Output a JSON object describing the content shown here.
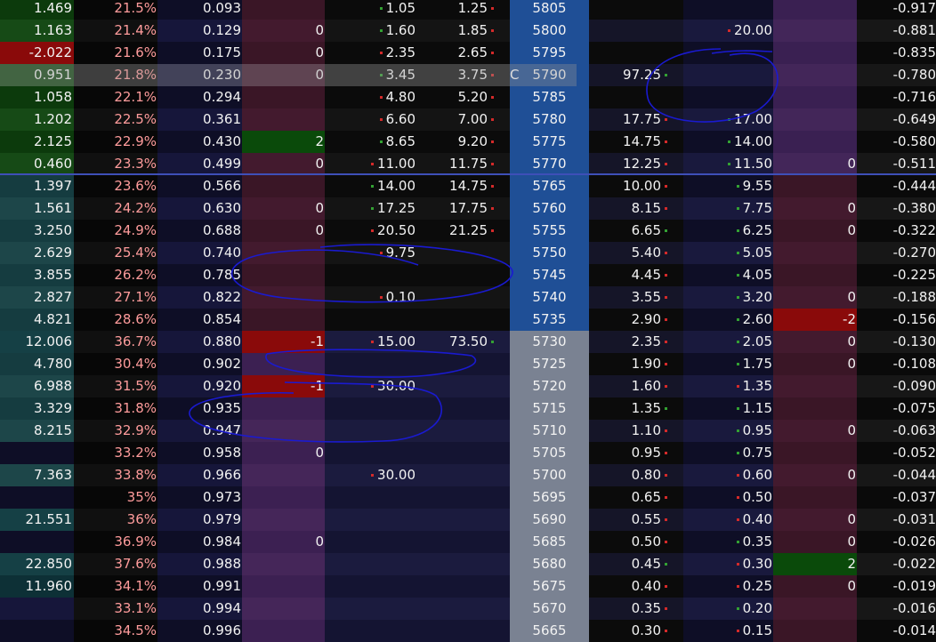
{
  "screen": {
    "name": "option-chain",
    "current_strike_flag": "C",
    "colors": {
      "text": "#f2f2f2",
      "iv_text": "#ff9c9c",
      "up_tick": "#33a133",
      "down_tick": "#d42a2a",
      "strike_itm": "#1f4f96",
      "strike_otm": "#7a8292",
      "annotation_ink": "#1010c8"
    }
  },
  "rows": [
    {
      "strike": "5805",
      "call_value": "1.469",
      "call_iv": "21.5%",
      "call_delta": "0.093",
      "call_pos": "",
      "call_bid": "1.05",
      "call_ask": "1.25",
      "bid_tick": "green",
      "ask_tick": "red",
      "put_bid": "",
      "put_ask": "",
      "pb_tick": "",
      "pa_tick": "",
      "put_pos": "",
      "put_delta": "-0.917"
    },
    {
      "strike": "5800",
      "call_value": "1.163",
      "call_iv": "21.4%",
      "call_delta": "0.129",
      "call_pos": "0",
      "call_bid": "1.60",
      "call_ask": "1.85",
      "bid_tick": "green",
      "ask_tick": "red",
      "put_bid": "",
      "put_ask": "20.00",
      "pb_tick": "",
      "pa_tick": "red",
      "put_pos": "",
      "put_delta": "-0.881"
    },
    {
      "strike": "5795",
      "call_value": "-2.022",
      "call_iv": "21.6%",
      "call_delta": "0.175",
      "call_pos": "0",
      "call_bid": "2.35",
      "call_ask": "2.65",
      "bid_tick": "red",
      "ask_tick": "red",
      "put_bid": "",
      "put_ask": "",
      "pb_tick": "",
      "pa_tick": "",
      "put_pos": "",
      "put_delta": "-0.835"
    },
    {
      "strike": "5790",
      "call_value": "0.951",
      "call_iv": "21.8%",
      "call_delta": "0.230",
      "call_pos": "0",
      "call_bid": "3.45",
      "call_ask": "3.75",
      "bid_tick": "green",
      "ask_tick": "red",
      "put_bid": "97.25",
      "put_ask": "",
      "pb_tick": "green",
      "pa_tick": "",
      "put_pos": "",
      "put_delta": "-0.780"
    },
    {
      "strike": "5785",
      "call_value": "1.058",
      "call_iv": "22.1%",
      "call_delta": "0.294",
      "call_pos": "",
      "call_bid": "4.80",
      "call_ask": "5.20",
      "bid_tick": "red",
      "ask_tick": "red",
      "put_bid": "",
      "put_ask": "",
      "pb_tick": "",
      "pa_tick": "",
      "put_pos": "",
      "put_delta": "-0.716"
    },
    {
      "strike": "5780",
      "call_value": "1.202",
      "call_iv": "22.5%",
      "call_delta": "0.361",
      "call_pos": "",
      "call_bid": "6.60",
      "call_ask": "7.00",
      "bid_tick": "red",
      "ask_tick": "red",
      "put_bid": "17.75",
      "put_ask": "17.00",
      "pb_tick": "red",
      "pa_tick": "green",
      "put_pos": "",
      "put_delta": "-0.649"
    },
    {
      "strike": "5775",
      "call_value": "2.125",
      "call_iv": "22.9%",
      "call_delta": "0.430",
      "call_pos": "2",
      "call_bid": "8.65",
      "call_ask": "9.20",
      "bid_tick": "green",
      "ask_tick": "red",
      "put_bid": "14.75",
      "put_ask": "14.00",
      "pb_tick": "red",
      "pa_tick": "green",
      "put_pos": "",
      "put_delta": "-0.580"
    },
    {
      "strike": "5770",
      "call_value": "0.460",
      "call_iv": "23.3%",
      "call_delta": "0.499",
      "call_pos": "0",
      "call_bid": "11.00",
      "call_ask": "11.75",
      "bid_tick": "red",
      "ask_tick": "red",
      "put_bid": "12.25",
      "put_ask": "11.50",
      "pb_tick": "red",
      "pa_tick": "green",
      "put_pos": "0",
      "put_delta": "-0.511"
    },
    {
      "strike": "5765",
      "call_value": "1.397",
      "call_iv": "23.6%",
      "call_delta": "0.566",
      "call_pos": "",
      "call_bid": "14.00",
      "call_ask": "14.75",
      "bid_tick": "green",
      "ask_tick": "red",
      "put_bid": "10.00",
      "put_ask": "9.55",
      "pb_tick": "red",
      "pa_tick": "green",
      "put_pos": "",
      "put_delta": "-0.444"
    },
    {
      "strike": "5760",
      "call_value": "1.561",
      "call_iv": "24.2%",
      "call_delta": "0.630",
      "call_pos": "0",
      "call_bid": "17.25",
      "call_ask": "17.75",
      "bid_tick": "green",
      "ask_tick": "red",
      "put_bid": "8.15",
      "put_ask": "7.75",
      "pb_tick": "red",
      "pa_tick": "green",
      "put_pos": "0",
      "put_delta": "-0.380"
    },
    {
      "strike": "5755",
      "call_value": "3.250",
      "call_iv": "24.9%",
      "call_delta": "0.688",
      "call_pos": "0",
      "call_bid": "20.50",
      "call_ask": "21.25",
      "bid_tick": "red",
      "ask_tick": "red",
      "put_bid": "6.65",
      "put_ask": "6.25",
      "pb_tick": "green",
      "pa_tick": "green",
      "put_pos": "0",
      "put_delta": "-0.322"
    },
    {
      "strike": "5750",
      "call_value": "2.629",
      "call_iv": "25.4%",
      "call_delta": "0.740",
      "call_pos": "",
      "call_bid": "9.75",
      "call_ask": "",
      "bid_tick": "red",
      "ask_tick": "",
      "put_bid": "5.40",
      "put_ask": "5.05",
      "pb_tick": "red",
      "pa_tick": "green",
      "put_pos": "",
      "put_delta": "-0.270"
    },
    {
      "strike": "5745",
      "call_value": "3.855",
      "call_iv": "26.2%",
      "call_delta": "0.785",
      "call_pos": "",
      "call_bid": "",
      "call_ask": "",
      "bid_tick": "",
      "ask_tick": "",
      "put_bid": "4.45",
      "put_ask": "4.05",
      "pb_tick": "red",
      "pa_tick": "green",
      "put_pos": "",
      "put_delta": "-0.225"
    },
    {
      "strike": "5740",
      "call_value": "2.827",
      "call_iv": "27.1%",
      "call_delta": "0.822",
      "call_pos": "",
      "call_bid": "0.10",
      "call_ask": "",
      "bid_tick": "red",
      "ask_tick": "",
      "put_bid": "3.55",
      "put_ask": "3.20",
      "pb_tick": "red",
      "pa_tick": "green",
      "put_pos": "0",
      "put_delta": "-0.188"
    },
    {
      "strike": "5735",
      "call_value": "4.821",
      "call_iv": "28.6%",
      "call_delta": "0.854",
      "call_pos": "",
      "call_bid": "",
      "call_ask": "",
      "bid_tick": "",
      "ask_tick": "",
      "put_bid": "2.90",
      "put_ask": "2.60",
      "pb_tick": "red",
      "pa_tick": "green",
      "put_pos": "-2",
      "put_delta": "-0.156"
    },
    {
      "strike": "5730",
      "call_value": "12.006",
      "call_iv": "36.7%",
      "call_delta": "0.880",
      "call_pos": "-1",
      "call_bid": "15.00",
      "call_ask": "73.50",
      "bid_tick": "red",
      "ask_tick": "green",
      "put_bid": "2.35",
      "put_ask": "2.05",
      "pb_tick": "red",
      "pa_tick": "green",
      "put_pos": "0",
      "put_delta": "-0.130"
    },
    {
      "strike": "5725",
      "call_value": "4.780",
      "call_iv": "30.4%",
      "call_delta": "0.902",
      "call_pos": "",
      "call_bid": "",
      "call_ask": "",
      "bid_tick": "",
      "ask_tick": "",
      "put_bid": "1.90",
      "put_ask": "1.75",
      "pb_tick": "red",
      "pa_tick": "green",
      "put_pos": "0",
      "put_delta": "-0.108"
    },
    {
      "strike": "5720",
      "call_value": "6.988",
      "call_iv": "31.5%",
      "call_delta": "0.920",
      "call_pos": "-1",
      "call_bid": "30.00",
      "call_ask": "",
      "bid_tick": "red",
      "ask_tick": "",
      "put_bid": "1.60",
      "put_ask": "1.35",
      "pb_tick": "red",
      "pa_tick": "red",
      "put_pos": "",
      "put_delta": "-0.090"
    },
    {
      "strike": "5715",
      "call_value": "3.329",
      "call_iv": "31.8%",
      "call_delta": "0.935",
      "call_pos": "",
      "call_bid": "",
      "call_ask": "",
      "bid_tick": "",
      "ask_tick": "",
      "put_bid": "1.35",
      "put_ask": "1.15",
      "pb_tick": "green",
      "pa_tick": "green",
      "put_pos": "",
      "put_delta": "-0.075"
    },
    {
      "strike": "5710",
      "call_value": "8.215",
      "call_iv": "32.9%",
      "call_delta": "0.947",
      "call_pos": "",
      "call_bid": "",
      "call_ask": "",
      "bid_tick": "",
      "ask_tick": "",
      "put_bid": "1.10",
      "put_ask": "0.95",
      "pb_tick": "red",
      "pa_tick": "green",
      "put_pos": "0",
      "put_delta": "-0.063"
    },
    {
      "strike": "5705",
      "call_value": "",
      "call_iv": "33.2%",
      "call_delta": "0.958",
      "call_pos": "0",
      "call_bid": "",
      "call_ask": "",
      "bid_tick": "",
      "ask_tick": "",
      "put_bid": "0.95",
      "put_ask": "0.75",
      "pb_tick": "red",
      "pa_tick": "green",
      "put_pos": "",
      "put_delta": "-0.052"
    },
    {
      "strike": "5700",
      "call_value": "7.363",
      "call_iv": "33.8%",
      "call_delta": "0.966",
      "call_pos": "",
      "call_bid": "30.00",
      "call_ask": "",
      "bid_tick": "red",
      "ask_tick": "",
      "put_bid": "0.80",
      "put_ask": "0.60",
      "pb_tick": "red",
      "pa_tick": "red",
      "put_pos": "0",
      "put_delta": "-0.044"
    },
    {
      "strike": "5695",
      "call_value": "",
      "call_iv": "35%",
      "call_delta": "0.973",
      "call_pos": "",
      "call_bid": "",
      "call_ask": "",
      "bid_tick": "",
      "ask_tick": "",
      "put_bid": "0.65",
      "put_ask": "0.50",
      "pb_tick": "red",
      "pa_tick": "red",
      "put_pos": "",
      "put_delta": "-0.037"
    },
    {
      "strike": "5690",
      "call_value": "21.551",
      "call_iv": "36%",
      "call_delta": "0.979",
      "call_pos": "",
      "call_bid": "",
      "call_ask": "",
      "bid_tick": "",
      "ask_tick": "",
      "put_bid": "0.55",
      "put_ask": "0.40",
      "pb_tick": "red",
      "pa_tick": "red",
      "put_pos": "0",
      "put_delta": "-0.031"
    },
    {
      "strike": "5685",
      "call_value": "",
      "call_iv": "36.9%",
      "call_delta": "0.984",
      "call_pos": "0",
      "call_bid": "",
      "call_ask": "",
      "bid_tick": "",
      "ask_tick": "",
      "put_bid": "0.50",
      "put_ask": "0.35",
      "pb_tick": "red",
      "pa_tick": "green",
      "put_pos": "0",
      "put_delta": "-0.026"
    },
    {
      "strike": "5680",
      "call_value": "22.850",
      "call_iv": "37.6%",
      "call_delta": "0.988",
      "call_pos": "",
      "call_bid": "",
      "call_ask": "",
      "bid_tick": "",
      "ask_tick": "",
      "put_bid": "0.45",
      "put_ask": "0.30",
      "pb_tick": "green",
      "pa_tick": "red",
      "put_pos": "2",
      "put_delta": "-0.022"
    },
    {
      "strike": "5675",
      "call_value": "11.960",
      "call_iv": "34.1%",
      "call_delta": "0.991",
      "call_pos": "",
      "call_bid": "",
      "call_ask": "",
      "bid_tick": "",
      "ask_tick": "",
      "put_bid": "0.40",
      "put_ask": "0.25",
      "pb_tick": "red",
      "pa_tick": "red",
      "put_pos": "0",
      "put_delta": "-0.019"
    },
    {
      "strike": "5670",
      "call_value": "",
      "call_iv": "33.1%",
      "call_delta": "0.994",
      "call_pos": "",
      "call_bid": "",
      "call_ask": "",
      "bid_tick": "",
      "ask_tick": "",
      "put_bid": "0.35",
      "put_ask": "0.20",
      "pb_tick": "red",
      "pa_tick": "green",
      "put_pos": "",
      "put_delta": "-0.016"
    },
    {
      "strike": "5665",
      "call_value": "",
      "call_iv": "34.5%",
      "call_delta": "0.996",
      "call_pos": "",
      "call_bid": "",
      "call_ask": "",
      "bid_tick": "",
      "ask_tick": "",
      "put_bid": "0.30",
      "put_ask": "0.15",
      "pb_tick": "red",
      "pa_tick": "red",
      "put_pos": "",
      "put_delta": "-0.014"
    }
  ]
}
